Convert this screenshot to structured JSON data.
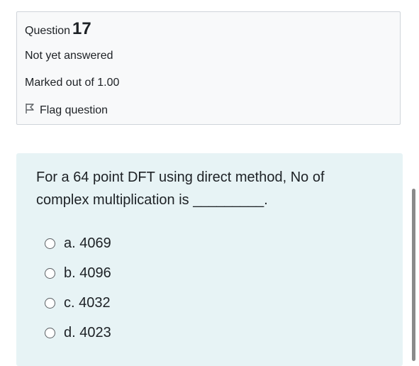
{
  "info": {
    "question_label": "Question",
    "question_number": "17",
    "status": "Not yet answered",
    "grade": "Marked out of 1.00",
    "flag_label": "Flag question"
  },
  "question": {
    "text": "For a 64 point DFT using direct method, No of complex multiplication is _________."
  },
  "answers": [
    {
      "label": "a. 4069"
    },
    {
      "label": "b. 4096"
    },
    {
      "label": "c. 4032"
    },
    {
      "label": "d. 4023"
    }
  ],
  "colors": {
    "info_bg": "#f8f9fa",
    "content_bg": "#e7f3f5",
    "text": "#1d2125"
  }
}
